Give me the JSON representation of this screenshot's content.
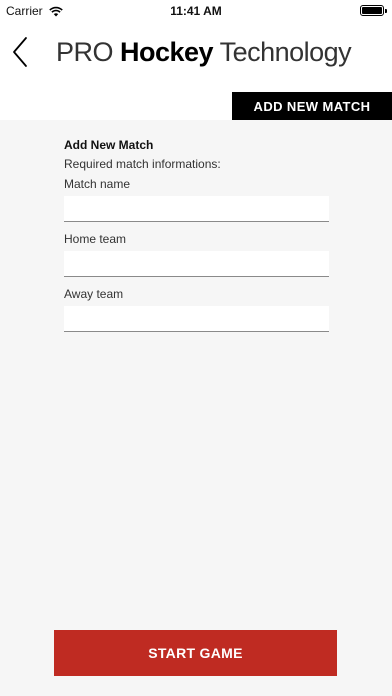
{
  "status_bar": {
    "carrier": "Carrier",
    "time": "11:41 AM"
  },
  "nav": {
    "title_prefix": "PRO ",
    "title_bold": "Hockey",
    "title_suffix": " Technology",
    "back_icon": "chevron-left-icon"
  },
  "header": {
    "add_new_match_label": "ADD NEW MATCH"
  },
  "form": {
    "title": "Add New Match",
    "subtitle": "Required match informations:",
    "fields": [
      {
        "label": "Match name",
        "value": "",
        "placeholder": ""
      },
      {
        "label": "Home team",
        "value": "",
        "placeholder": ""
      },
      {
        "label": "Away team",
        "value": "",
        "placeholder": ""
      }
    ]
  },
  "footer": {
    "start_game_label": "START GAME"
  },
  "colors": {
    "accent_red": "#bf2b22",
    "tab_black": "#000000",
    "background": "#f6f6f6"
  }
}
